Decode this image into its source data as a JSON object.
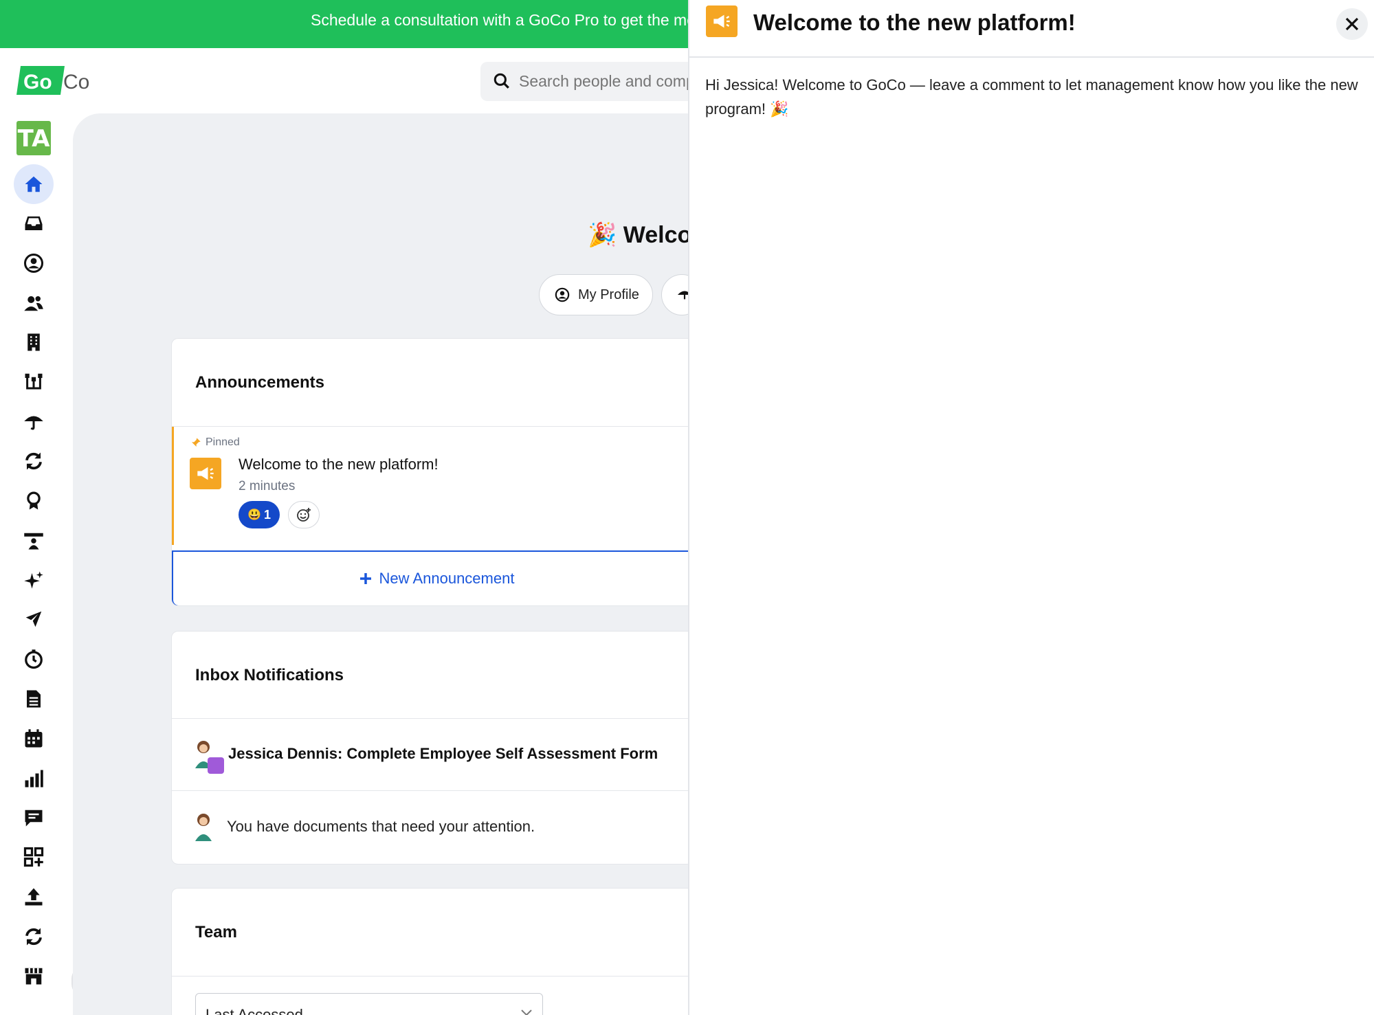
{
  "banner": {
    "text": "Schedule a consultation with a GoCo Pro to get the most out of your account"
  },
  "brand": {
    "logo_text_a": "Go",
    "logo_text_b": "Co",
    "company_tile": "TA",
    "green": "#1fbf5a",
    "accent": "#1a56db",
    "orange": "#f5a623"
  },
  "search": {
    "placeholder": "Search people and company"
  },
  "nav": {
    "items": [
      {
        "icon": "home-icon"
      },
      {
        "icon": "inbox-icon"
      },
      {
        "icon": "profile-icon"
      },
      {
        "icon": "people-icon"
      },
      {
        "icon": "building-icon"
      },
      {
        "icon": "org-chart-icon"
      },
      {
        "icon": "umbrella-icon"
      },
      {
        "icon": "sync-icon"
      },
      {
        "icon": "award-icon"
      },
      {
        "icon": "training-icon"
      },
      {
        "icon": "sparkles-icon"
      },
      {
        "icon": "plane-icon"
      },
      {
        "icon": "timer-icon"
      },
      {
        "icon": "document-icon"
      },
      {
        "icon": "calendar-icon"
      },
      {
        "icon": "bar-chart-icon"
      },
      {
        "icon": "message-icon"
      },
      {
        "icon": "apps-icon"
      },
      {
        "icon": "upload-icon"
      },
      {
        "icon": "refresh-icon"
      },
      {
        "icon": "marketplace-icon"
      }
    ]
  },
  "home": {
    "welcome": "Welco",
    "profile_button": "My Profile"
  },
  "announcements": {
    "title": "Announcements",
    "pinned_label": "Pinned",
    "item_title": "Welcome to the new platform!",
    "item_time": "2 minutes",
    "reaction_count": "1",
    "new_button": "New Announcement"
  },
  "inbox": {
    "title": "Inbox Notifications",
    "row1": "Jessica Dennis: Complete Employee Self Assessment Form",
    "row2": "You have documents that need your attention."
  },
  "team": {
    "title": "Team",
    "select_value": "Last Accessed"
  },
  "drawer": {
    "title": "Welcome to the new platform!",
    "body": "Hi Jessica! Welcome to GoCo — leave a comment to let management know how you like the new program! 🎉"
  }
}
